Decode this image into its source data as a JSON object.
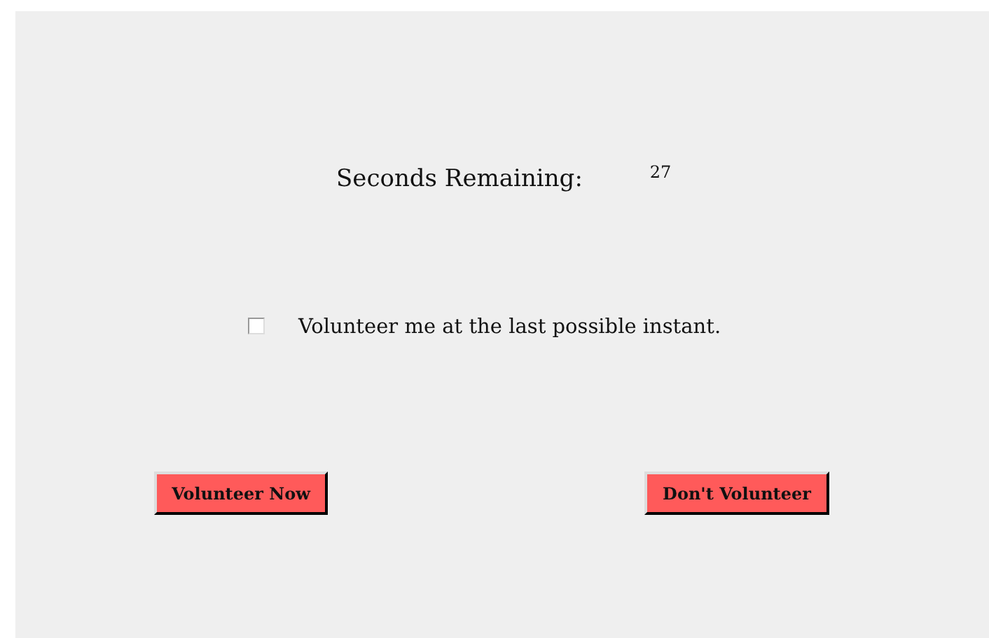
{
  "timer": {
    "label": "Seconds Remaining:",
    "value": "27"
  },
  "option": {
    "label": "Volunteer me at the last possible instant.",
    "checked": false
  },
  "buttons": [
    {
      "label": "Volunteer Now"
    },
    {
      "label": "Don't Volunteer"
    }
  ]
}
